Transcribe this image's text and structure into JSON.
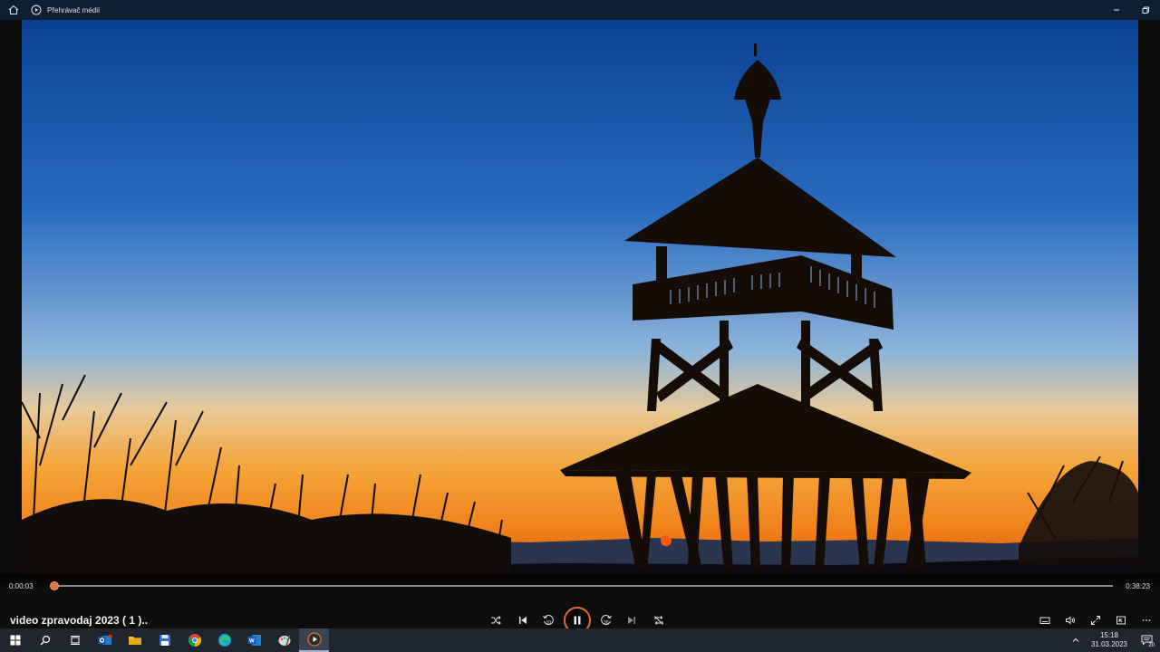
{
  "window": {
    "title": "Přehrávač médií",
    "icons": {
      "home": "home-icon",
      "app": "media-player-icon"
    },
    "controls": [
      "minimize-icon",
      "restore-icon"
    ]
  },
  "player": {
    "current_time": "0:00:03",
    "total_time": "0:38:23",
    "progress_fraction": 0.0013,
    "media_title": "video zpravodaj 2023 ( 1 )..",
    "accent_color": "#e36a3a",
    "state": "playing",
    "skip_back_seconds": "10",
    "skip_forward_seconds": "30"
  },
  "taskbar": {
    "apps": [
      "start",
      "search",
      "task-view",
      "outlook",
      "file-explorer",
      "save-app",
      "chrome",
      "edge",
      "word",
      "paint",
      "media-player"
    ],
    "clock_time": "15:18",
    "clock_date": "31.03.2023",
    "notification_count": "20"
  }
}
